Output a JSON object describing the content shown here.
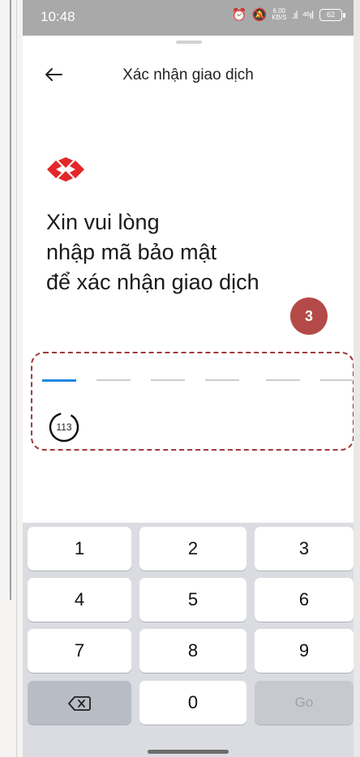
{
  "status_bar": {
    "time": "10:48",
    "net_speed_value": "6.00",
    "net_speed_unit": "KB/S",
    "battery": "62"
  },
  "header": {
    "title": "Xác nhận giao dịch"
  },
  "prompt": {
    "line1": "Xin vui lòng",
    "line2": "nhập mã bảo mật",
    "line3": "để xác nhận giao dịch"
  },
  "annotation": {
    "step_number": "3"
  },
  "otp": {
    "slots": 6,
    "active_index": 0
  },
  "timer": {
    "seconds": "113"
  },
  "keyboard": {
    "keys": [
      "1",
      "2",
      "3",
      "4",
      "5",
      "6",
      "7",
      "8",
      "9"
    ],
    "zero": "0",
    "go_label": "Go"
  },
  "colors": {
    "brand_red": "#e4262a",
    "annotation_red": "#b34a47",
    "otp_active": "#1e88e5"
  },
  "icons": {
    "back": "arrow-left-icon",
    "backspace": "backspace-icon",
    "logo": "bank-logo-icon"
  }
}
